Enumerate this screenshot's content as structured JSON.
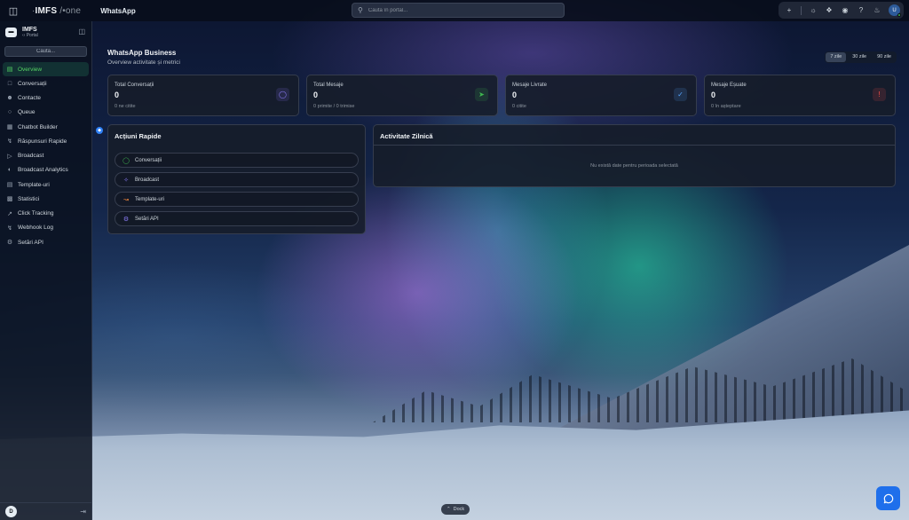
{
  "topbar": {
    "brand_prefix": "·",
    "brand": "IMFS",
    "brand_suffix": "/•one",
    "app_title": "WhatsApp",
    "search_placeholder": "Caută în portal..."
  },
  "sidebar": {
    "org_name": "IMFS",
    "org_sub": "‹› Portal",
    "search_placeholder": "Cauta...",
    "items": [
      {
        "label": "Overview",
        "icon": "chart-icon",
        "active": true
      },
      {
        "label": "Conversații",
        "icon": "chat-icon"
      },
      {
        "label": "Contacte",
        "icon": "users-icon"
      },
      {
        "label": "Queue",
        "icon": "queue-icon"
      },
      {
        "label": "Chatbot Builder",
        "icon": "bot-icon"
      },
      {
        "label": "Răspunsuri Rapide",
        "icon": "bolt-icon"
      },
      {
        "label": "Broadcast",
        "icon": "megaphone-icon"
      },
      {
        "label": "Broadcast Analytics",
        "icon": "analytics-icon"
      },
      {
        "label": "Template-uri",
        "icon": "template-icon"
      },
      {
        "label": "Statistici",
        "icon": "stats-icon"
      },
      {
        "label": "Click Tracking",
        "icon": "click-icon"
      },
      {
        "label": "Webhook Log",
        "icon": "webhook-icon"
      },
      {
        "label": "Setări API",
        "icon": "settings-icon"
      }
    ],
    "user_initial": "D"
  },
  "page": {
    "title": "WhatsApp Business",
    "subtitle": "Overview activitate și metrici",
    "ranges": [
      "7 zile",
      "30 zile",
      "90 zile"
    ],
    "active_range": "7 zile"
  },
  "stats": [
    {
      "label": "Total Conversații",
      "value": "0",
      "sub": "0 ne citite",
      "icon": "chat-bubble-icon",
      "color": "#8b7cf6"
    },
    {
      "label": "Total Mesaje",
      "value": "0",
      "sub": "0 primite / 0 trimise",
      "icon": "send-icon",
      "color": "#3fb950"
    },
    {
      "label": "Mesaje Livrate",
      "value": "0",
      "sub": "0 citite",
      "icon": "check-circle-icon",
      "color": "#58a6ff"
    },
    {
      "label": "Mesaje Eșuate",
      "value": "0",
      "sub": "0 în așteptare",
      "icon": "alert-circle-icon",
      "color": "#f85149"
    }
  ],
  "quick_actions": {
    "title": "Acțiuni Rapide",
    "items": [
      {
        "label": "Conversații",
        "icon": "chat-icon",
        "color": "#3fb950"
      },
      {
        "label": "Broadcast",
        "icon": "megaphone-icon",
        "color": "#8b7cf6"
      },
      {
        "label": "Template-uri",
        "icon": "template-icon",
        "color": "#f0883e"
      },
      {
        "label": "Setări API",
        "icon": "settings-icon",
        "color": "#8b7cf6"
      }
    ]
  },
  "activity": {
    "title": "Activitate Zilnică",
    "empty": "Nu există date pentru perioada selectată"
  },
  "dock_label": "Dock"
}
